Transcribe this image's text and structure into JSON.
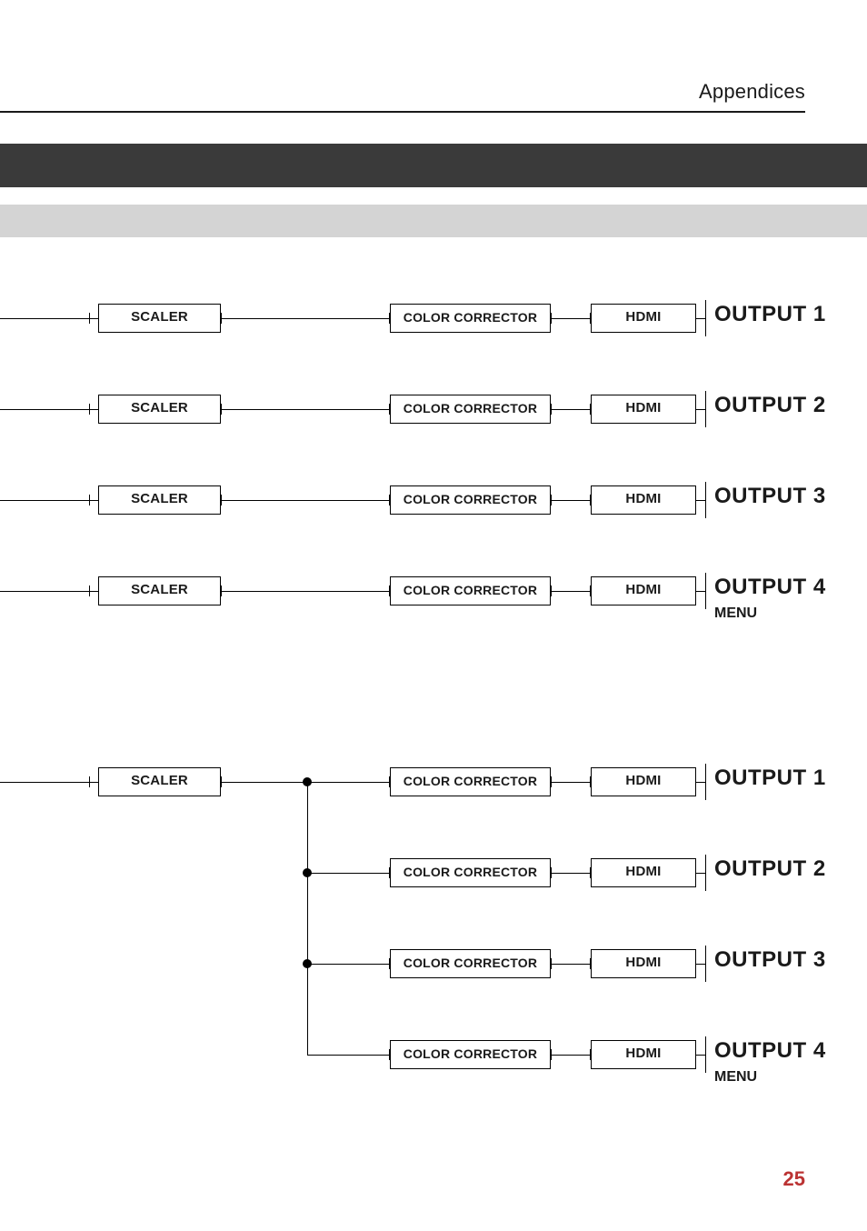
{
  "header": {
    "section": "Appendices"
  },
  "labels": {
    "scaler": "SCALER",
    "color_corrector": "COLOR CORRECTOR",
    "hdmi": "HDMI",
    "menu": "MENU"
  },
  "diagram_a": {
    "rows": [
      {
        "output": "OUTPUT 1",
        "has_menu": false
      },
      {
        "output": "OUTPUT 2",
        "has_menu": false
      },
      {
        "output": "OUTPUT 3",
        "has_menu": false
      },
      {
        "output": "OUTPUT 4",
        "has_menu": true
      }
    ]
  },
  "diagram_b": {
    "rows": [
      {
        "output": "OUTPUT 1",
        "has_menu": false
      },
      {
        "output": "OUTPUT 2",
        "has_menu": false
      },
      {
        "output": "OUTPUT 3",
        "has_menu": false
      },
      {
        "output": "OUTPUT 4",
        "has_menu": true
      }
    ]
  },
  "page_number": "25"
}
